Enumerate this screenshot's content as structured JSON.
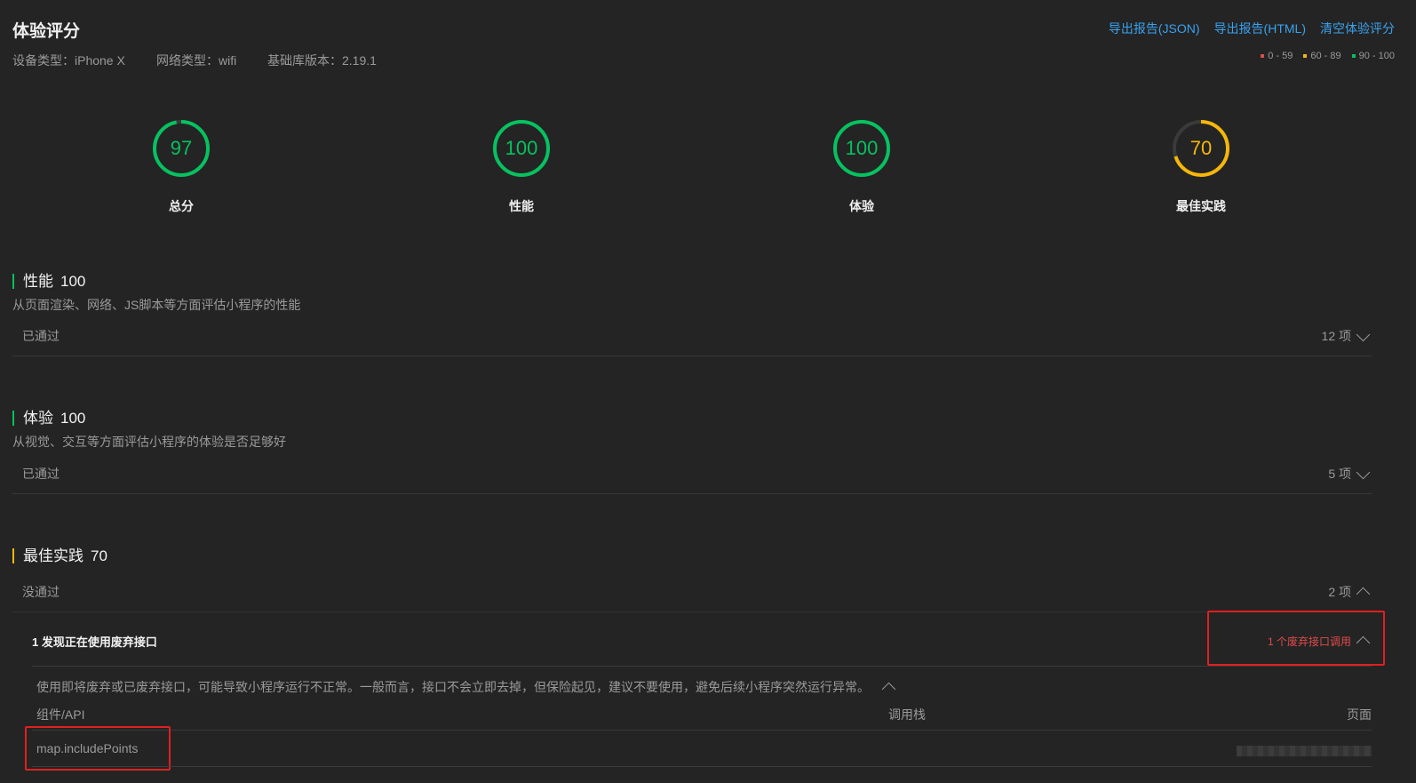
{
  "header": {
    "title": "体验评分",
    "device": "设备类型：iPhone X",
    "network": "网络类型：wifi",
    "lib_version": "基础库版本：2.19.1",
    "links": [
      "导出报告(JSON)",
      "导出报告(HTML)",
      "清空体验评分"
    ],
    "legend": [
      {
        "label": "0 - 59",
        "color": "#e04a4a"
      },
      {
        "label": "60 - 89",
        "color": "#f5b70a"
      },
      {
        "label": "90 - 100",
        "color": "#07c160"
      }
    ]
  },
  "scores": [
    {
      "value": "97",
      "label": "总分",
      "fraction": 0.97,
      "color": "#07c160"
    },
    {
      "value": "100",
      "label": "性能",
      "fraction": 1.0,
      "color": "#07c160"
    },
    {
      "value": "100",
      "label": "体验",
      "fraction": 1.0,
      "color": "#07c160"
    },
    {
      "value": "70",
      "label": "最佳实践",
      "fraction": 0.7,
      "color": "#f5b70a"
    }
  ],
  "sections": {
    "performance": {
      "title": "性能",
      "score": "100",
      "desc": "从页面渲染、网络、JS脚本等方面评估小程序的性能",
      "status": "已通过",
      "count": "12 项"
    },
    "experience": {
      "title": "体验",
      "score": "100",
      "desc": "从视觉、交互等方面评估小程序的体验是否足够好",
      "status": "已通过",
      "count": "5 项"
    },
    "best_practice": {
      "title": "最佳实践",
      "score": "70",
      "status": "没通过",
      "count": "2 项",
      "item": {
        "title": "1 发现正在使用废弃接口",
        "badge": "1 个废弃接口调用",
        "desc": "使用即将废弃或已废弃接口，可能导致小程序运行不正常。一般而言，接口不会立即去掉，但保险起见，建议不要使用，避免后续小程序突然运行异常。",
        "columns": [
          "组件/API",
          "调用栈",
          "页面"
        ],
        "rows": [
          {
            "api": "map.includePoints"
          }
        ]
      }
    }
  },
  "colors": {
    "accent_green": "#07c160",
    "accent_yellow": "#f5b70a",
    "alert_red": "#e02020",
    "link_blue": "#3aa2f0"
  }
}
